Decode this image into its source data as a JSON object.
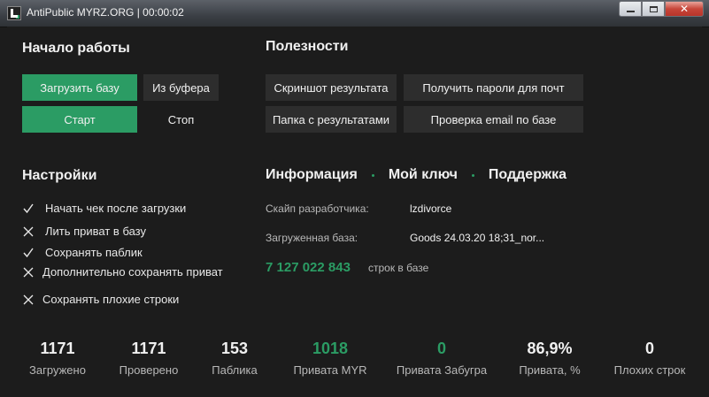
{
  "window": {
    "title": "AntiPublic MYRZ.ORG | 00:00:02",
    "close_label": "✕"
  },
  "colors": {
    "accent": "#2b9c64",
    "background": "#1c1c1c",
    "button_gray": "#2d2d2d"
  },
  "start_section": {
    "heading": "Начало работы",
    "load_base_label": "Загрузить базу",
    "from_clipboard_label": "Из буфера",
    "start_label": "Старт",
    "stop_label": "Стоп"
  },
  "utilities": {
    "heading": "Полезности",
    "screenshot_label": "Скриншот результата",
    "get_passwords_label": "Получить пароли для почт",
    "results_folder_label": "Папка с результатами",
    "check_email_label": "Проверка email по базе"
  },
  "settings": {
    "heading": "Настройки",
    "items": [
      {
        "label": "Начать чек после загрузки",
        "checked": true,
        "icon": "check-icon"
      },
      {
        "label": "Лить приват в базу",
        "checked": false,
        "icon": "cross-icon"
      },
      {
        "label": "Сохранять паблик",
        "checked": true,
        "icon": "check-icon"
      },
      {
        "label": "Дополнительно сохранять приват",
        "checked": false,
        "icon": "cross-icon"
      },
      {
        "label": "Сохранять плохие строки",
        "checked": false,
        "icon": "cross-icon"
      }
    ]
  },
  "info": {
    "tabs": [
      "Информация",
      "Мой ключ",
      "Поддержка"
    ],
    "skype_label": "Скайп разработчика:",
    "skype_value": "lzdivorce",
    "base_label": "Загруженная база:",
    "base_value": "Goods 24.03.20 18;31_nor...",
    "lines_count": "7 127 022 843",
    "lines_label": "строк в базе"
  },
  "stats": [
    {
      "value": "1171",
      "label": "Загружено",
      "green": false
    },
    {
      "value": "1171",
      "label": "Проверено",
      "green": false
    },
    {
      "value": "153",
      "label": "Паблика",
      "green": false
    },
    {
      "value": "1018",
      "label": "Привата MYR",
      "green": true
    },
    {
      "value": "0",
      "label": "Привата Забугра",
      "green": true
    },
    {
      "value": "86,9%",
      "label": "Привата, %",
      "green": false
    },
    {
      "value": "0",
      "label": "Плохих строк",
      "green": false
    }
  ]
}
